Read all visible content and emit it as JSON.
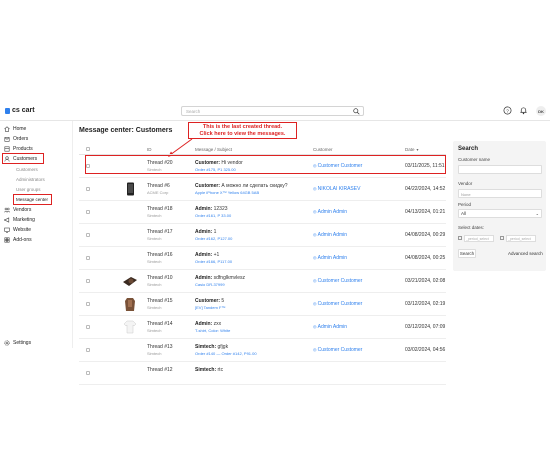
{
  "app": {
    "logo_text": "cs cart"
  },
  "search": {
    "placeholder": "Search"
  },
  "user": {
    "initials": "DK"
  },
  "sidebar": {
    "items": [
      {
        "label": "Home",
        "icon": "home-icon"
      },
      {
        "label": "Orders",
        "icon": "orders-icon"
      },
      {
        "label": "Products",
        "icon": "products-icon"
      },
      {
        "label": "Customers",
        "icon": "customers-icon"
      },
      {
        "label": "Vendors",
        "icon": "vendors-icon"
      },
      {
        "label": "Marketing",
        "icon": "marketing-icon"
      },
      {
        "label": "Website",
        "icon": "website-icon"
      },
      {
        "label": "Add-ons",
        "icon": "addons-icon"
      }
    ],
    "subitems": [
      "Customers",
      "Administrators",
      "User groups",
      "Message center"
    ],
    "settings_label": "Settings"
  },
  "page": {
    "title": "Message center: Customers",
    "callout": [
      "This is the last created thread.",
      "Click here to view the messages."
    ]
  },
  "table": {
    "headers": [
      "ID",
      "Message / Subject",
      "Customer",
      "Date"
    ],
    "sort_indicator": "▼",
    "rows": [
      {
        "id": "Thread #20",
        "sub": "Simtech",
        "subj_bold": "Customer:",
        "subj": "Hi vendor",
        "order": "Order #175, P1 325.00",
        "customer": "Customer Customer",
        "date": "03/11/2025, 11:51",
        "thumb": ""
      },
      {
        "id": "Thread #6",
        "sub": "ACME Corp",
        "subj_bold": "Customer:",
        "subj": "А можно ли сделать скидку?",
        "order": "Apple iPhone Х™ Yellow 64GB 5AB",
        "customer": "NIKOLAI KIRASEV",
        "date": "04/22/2024, 14:52",
        "thumb": "phone"
      },
      {
        "id": "Thread #18",
        "sub": "Simtech",
        "subj_bold": "Admin:",
        "subj": "12323",
        "order": "Order #161, P 33.00",
        "customer": "Admin Admin",
        "date": "04/13/2024, 01:21",
        "thumb": ""
      },
      {
        "id": "Thread #17",
        "sub": "Simtech",
        "subj_bold": "Admin:",
        "subj": "1",
        "order": "Order #162, P127.00",
        "customer": "Admin Admin",
        "date": "04/08/2024, 00:29",
        "thumb": ""
      },
      {
        "id": "Thread #16",
        "sub": "Simtech",
        "subj_bold": "Admin:",
        "subj": "+1",
        "order": "Order #166, P117.00",
        "customer": "Admin Admin",
        "date": "04/08/2024, 00:25",
        "thumb": ""
      },
      {
        "id": "Thread #10",
        "sub": "Simtech",
        "subj_bold": "Admin:",
        "subj": "sdfnglkmvlesz",
        "order": "Casio DR-37999",
        "customer": "Customer Customer",
        "date": "03/21/2024, 02:08",
        "thumb": "camera"
      },
      {
        "id": "Thread #15",
        "sub": "Simtech",
        "subj_bold": "Customer:",
        "subj": "5",
        "order": "[EV] Tandem F™",
        "customer": "Customer Customer",
        "date": "03/12/2024, 02:19",
        "thumb": "clothes"
      },
      {
        "id": "Thread #14",
        "sub": "Simtech",
        "subj_bold": "Admin:",
        "subj": "zxx",
        "order": "T-shirt, Color: White",
        "customer": "Admin Admin",
        "date": "03/12/2024, 07:09",
        "thumb": "tshirt"
      },
      {
        "id": "Thread #13",
        "sub": "Simtech",
        "subj_bold": "Simtech:",
        "subj": "gfjgk",
        "order": "Order #140 — Order #142, P91.00",
        "customer": "Customer Customer",
        "date": "03/02/2024, 04:56",
        "thumb": ""
      },
      {
        "id": "Thread #12",
        "sub": "",
        "subj_bold": "Simtech:",
        "subj": "rtc",
        "order": "",
        "customer": "",
        "date": "",
        "thumb": ""
      }
    ]
  },
  "filter": {
    "title": "Search",
    "customer_name_label": "Customer name",
    "vendor_label": "Vendor",
    "vendor_placeholder": "None",
    "period_label": "Period",
    "period_value": "All",
    "dates_label": "Select dates:",
    "from_placeholder": "_period_select",
    "to_placeholder": "_period_select",
    "search_button": "Search",
    "advanced_link": "Advanced search"
  },
  "colors": {
    "accent": "#2f80ed",
    "highlight": "#dd2222"
  }
}
